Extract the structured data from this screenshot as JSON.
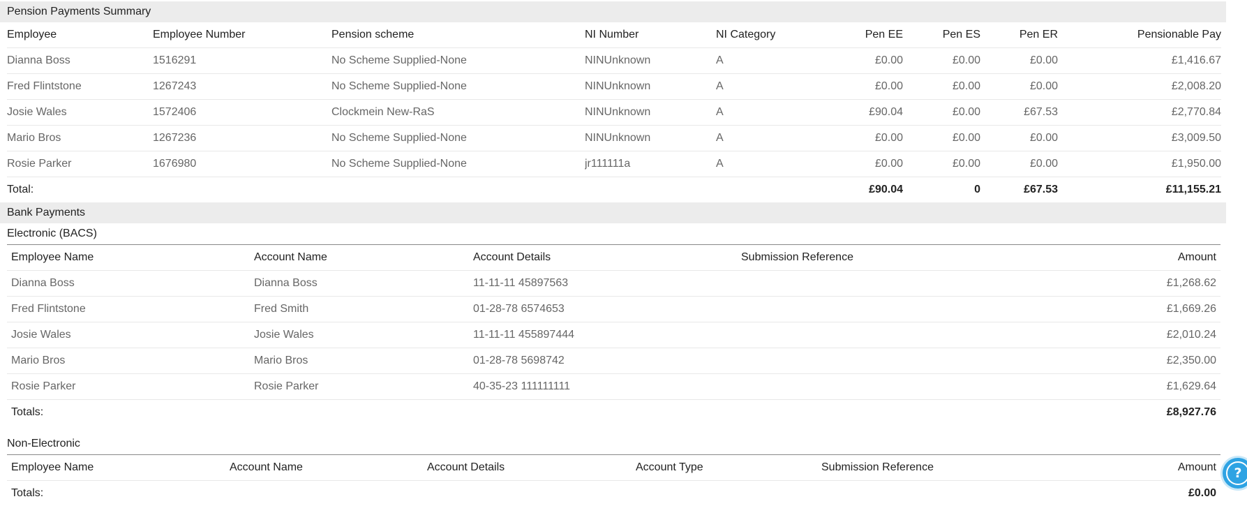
{
  "pension": {
    "title": "Pension Payments Summary",
    "headers": [
      "Employee",
      "Employee Number",
      "Pension scheme",
      "NI Number",
      "NI Category",
      "Pen EE",
      "Pen ES",
      "Pen ER",
      "Pensionable Pay"
    ],
    "rows": [
      [
        "Dianna Boss",
        "1516291",
        "No Scheme Supplied-None",
        "NINUnknown",
        "A",
        "£0.00",
        "£0.00",
        "£0.00",
        "£1,416.67"
      ],
      [
        "Fred Flintstone",
        "1267243",
        "No Scheme Supplied-None",
        "NINUnknown",
        "A",
        "£0.00",
        "£0.00",
        "£0.00",
        "£2,008.20"
      ],
      [
        "Josie Wales",
        "1572406",
        "Clockmein New-RaS",
        "NINUnknown",
        "A",
        "£90.04",
        "£0.00",
        "£67.53",
        "£2,770.84"
      ],
      [
        "Mario Bros",
        "1267236",
        "No Scheme Supplied-None",
        "NINUnknown",
        "A",
        "£0.00",
        "£0.00",
        "£0.00",
        "£3,009.50"
      ],
      [
        "Rosie Parker",
        "1676980",
        "No Scheme Supplied-None",
        "jr111111a",
        "A",
        "£0.00",
        "£0.00",
        "£0.00",
        "£1,950.00"
      ]
    ],
    "total": {
      "label": "Total:",
      "pen_ee": "£90.04",
      "pen_es": "0",
      "pen_er": "£67.53",
      "pensionable_pay": "£11,155.21"
    }
  },
  "bank": {
    "title": "Bank Payments",
    "electronic": {
      "title": "Electronic (BACS)",
      "headers": [
        "Employee Name",
        "Account Name",
        "Account Details",
        "Submission Reference",
        "Amount"
      ],
      "rows": [
        [
          "Dianna Boss",
          "Dianna Boss",
          "11-11-11 45897563",
          "",
          "£1,268.62"
        ],
        [
          "Fred Flintstone",
          "Fred Smith",
          "01-28-78 6574653",
          "",
          "£1,669.26"
        ],
        [
          "Josie Wales",
          "Josie Wales",
          "11-11-11 455897444",
          "",
          "£2,010.24"
        ],
        [
          "Mario Bros",
          "Mario Bros",
          "01-28-78 5698742",
          "",
          "£2,350.00"
        ],
        [
          "Rosie Parker",
          "Rosie Parker",
          "40-35-23 111111111",
          "",
          "£1,629.64"
        ]
      ],
      "totals_label": "Totals:",
      "totals_amount": "£8,927.76"
    },
    "non_electronic": {
      "title": "Non-Electronic",
      "headers": [
        "Employee Name",
        "Account Name",
        "Account Details",
        "Account Type",
        "Submission Reference",
        "Amount"
      ],
      "totals_label": "Totals:",
      "totals_amount": "£0.00"
    }
  },
  "help": {
    "glyph": "?",
    "icon": "question-circle-icon",
    "color": "#2ea3e3"
  }
}
